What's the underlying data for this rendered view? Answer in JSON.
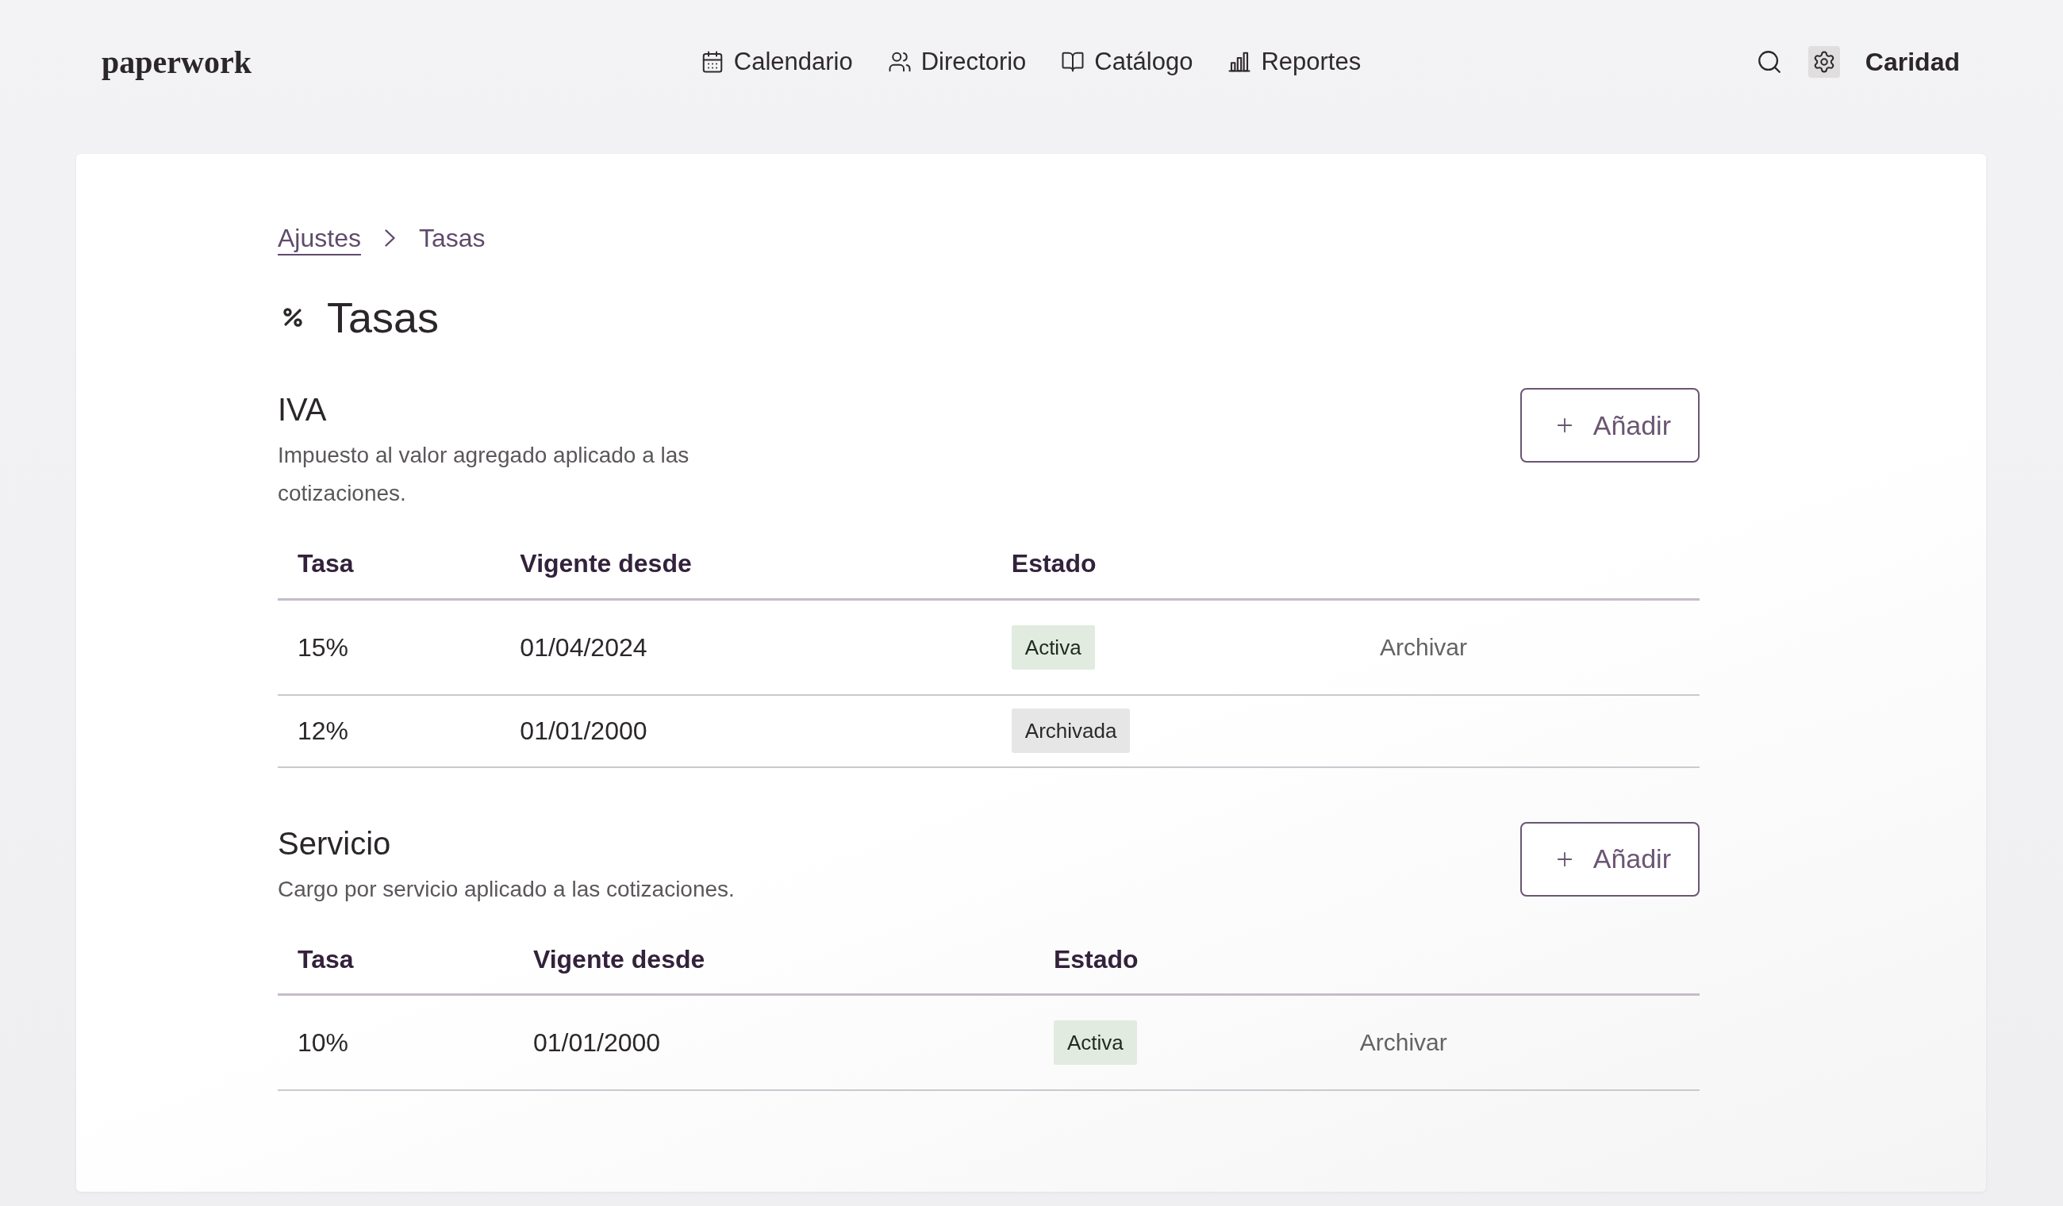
{
  "header": {
    "logo": "paperwork",
    "nav": [
      {
        "label": "Calendario",
        "kind": "calendar"
      },
      {
        "label": "Directorio",
        "kind": "people"
      },
      {
        "label": "Catálogo",
        "kind": "book"
      },
      {
        "label": "Reportes",
        "kind": "chart"
      }
    ],
    "settings": {
      "selected": true
    },
    "user": "Caridad"
  },
  "breadcrumb": [
    {
      "label": "Ajustes",
      "kind": "link"
    },
    {
      "label": "Tasas",
      "kind": "current"
    }
  ],
  "page_title": "Tasas",
  "sections": [
    {
      "title": "IVA",
      "description": "Impuesto al valor agregado aplicado a las cotizaciones.",
      "add_button": "Añadir",
      "table": {
        "columns": [
          "Tasa",
          "Vigente desde",
          "Estado"
        ],
        "rows": [
          {
            "rate": "15%",
            "since": "01/04/2024",
            "status": {
              "label": "Activa",
              "kind": "active"
            },
            "action": "Archivar"
          },
          {
            "rate": "12%",
            "since": "01/01/2000",
            "status": {
              "label": "Archivada",
              "kind": "archived"
            }
          }
        ]
      }
    },
    {
      "title": "Servicio",
      "description": "Cargo por servicio aplicado a las cotizaciones.",
      "add_button": "Añadir",
      "table": {
        "columns": [
          "Tasa",
          "Vigente desde",
          "Estado"
        ],
        "rows": [
          {
            "rate": "10%",
            "since": "01/01/2000",
            "status": {
              "label": "Activa",
              "kind": "active"
            },
            "action": "Archivar"
          }
        ]
      }
    }
  ]
}
